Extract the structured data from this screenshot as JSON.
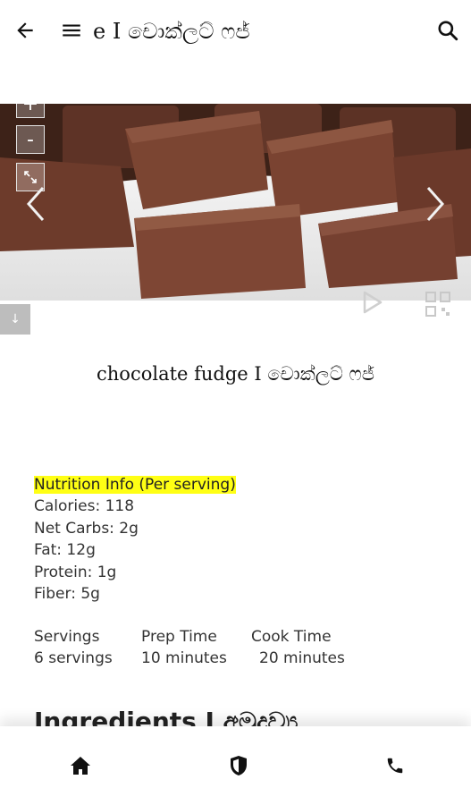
{
  "header": {
    "title": "e I චොක්ලට් ෆජ්",
    "back_icon": "arrow-left-icon",
    "menu_icon": "menu-icon",
    "search_icon": "search-icon"
  },
  "slider": {
    "zoom_in_label": "+",
    "zoom_out_label": "-",
    "down_label": "↓"
  },
  "recipe": {
    "title": "chocolate fudge I චොක්ලට් ෆජ්"
  },
  "nutrition": {
    "heading": "Nutrition Info (Per serving)",
    "lines": [
      "Calories: 118",
      "Net Carbs: 2g",
      "Fat: 12g",
      "Protein: 1g",
      "Fiber: 5g"
    ]
  },
  "meta": {
    "servings_label": "Servings",
    "servings_value": "6 servings",
    "prep_label": "Prep Time",
    "prep_value": "10 minutes",
    "cook_label": "Cook Time",
    "cook_value": "20 minutes"
  },
  "ingredients_heading": "Ingredients I අමුද්‍රව්‍ය",
  "bottom_nav": [
    "home-icon",
    "shield-icon",
    "phone-icon"
  ],
  "colors": {
    "highlight": "#ffff14",
    "fudge": "#6a3a2a"
  }
}
